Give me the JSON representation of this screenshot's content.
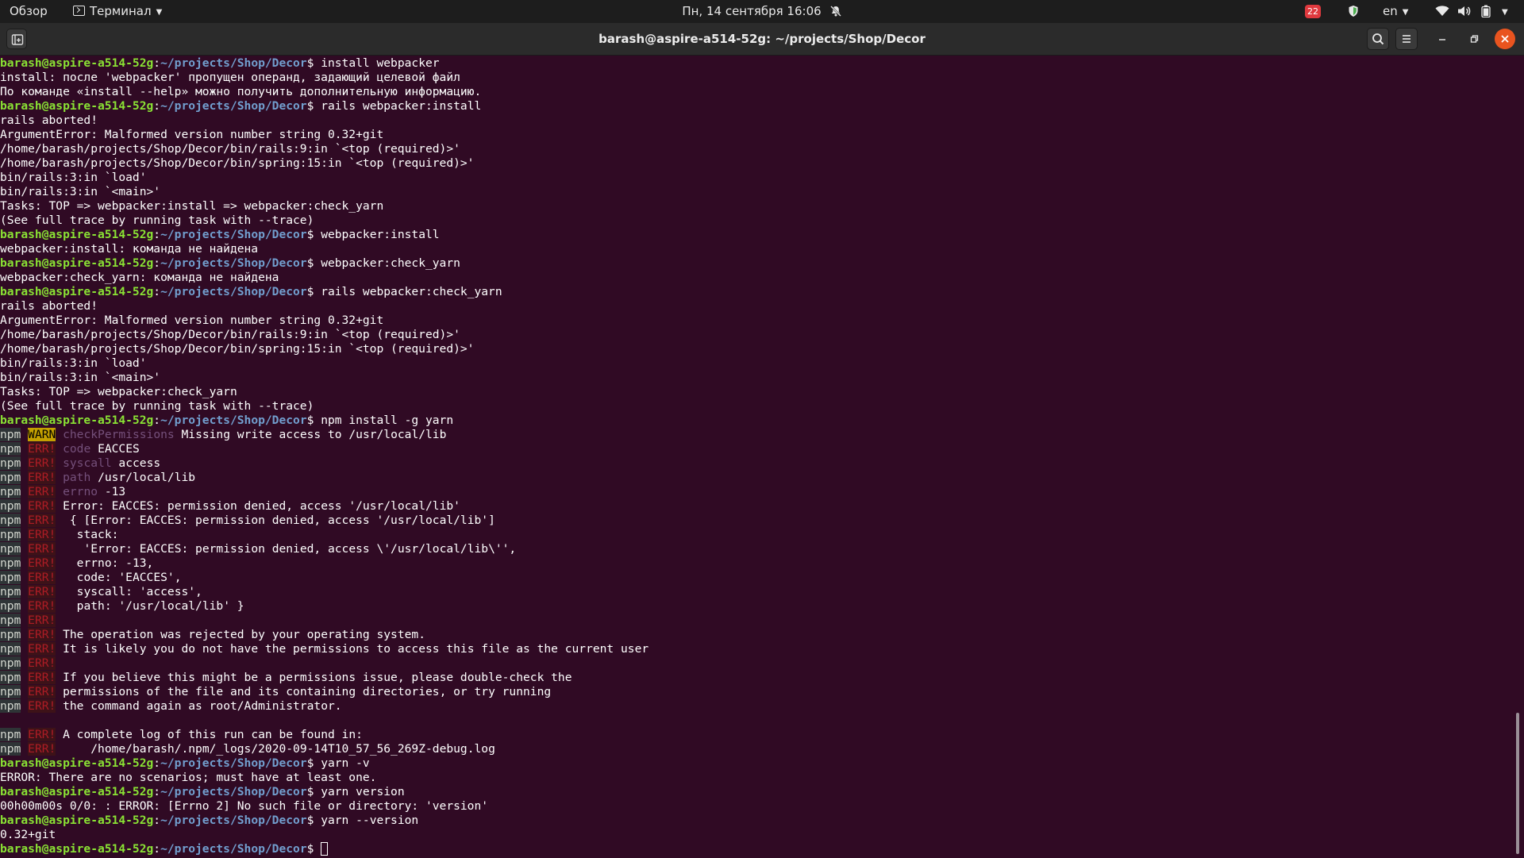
{
  "topbar": {
    "overview": "Обзор",
    "app_name": "Терминал",
    "datetime": "Пн, 14 сентября  16:06",
    "notification_count": "22",
    "language": "en"
  },
  "window": {
    "title": "barash@aspire-a514-52g: ~/projects/Shop/Decor"
  },
  "colors": {
    "terminal_bg": "#300a24",
    "prompt_user": "#8ae234",
    "prompt_path": "#729fcf",
    "npm_warn": "#c4a000",
    "npm_err": "#ad1c25",
    "close_button": "#e9541f"
  },
  "terminal": {
    "prompt_user": "barash@aspire-a514-52g",
    "prompt_path": "~/projects/Shop/Decor",
    "npm": "npm",
    "warn": "WARN",
    "err": "ERR!",
    "lines": [
      {
        "t": "prompt",
        "cmd": "install webpacker"
      },
      {
        "t": "text",
        "text": "install: после 'webpacker' пропущен операнд, задающий целевой файл"
      },
      {
        "t": "text",
        "text": "По команде «install --help» можно получить дополнительную информацию."
      },
      {
        "t": "prompt",
        "cmd": "rails webpacker:install"
      },
      {
        "t": "text",
        "text": "rails aborted!"
      },
      {
        "t": "text",
        "text": "ArgumentError: Malformed version number string 0.32+git"
      },
      {
        "t": "text",
        "text": "/home/barash/projects/Shop/Decor/bin/rails:9:in `<top (required)>'"
      },
      {
        "t": "text",
        "text": "/home/barash/projects/Shop/Decor/bin/spring:15:in `<top (required)>'"
      },
      {
        "t": "text",
        "text": "bin/rails:3:in `load'"
      },
      {
        "t": "text",
        "text": "bin/rails:3:in `<main>'"
      },
      {
        "t": "text",
        "text": "Tasks: TOP => webpacker:install => webpacker:check_yarn"
      },
      {
        "t": "text",
        "text": "(See full trace by running task with --trace)"
      },
      {
        "t": "prompt",
        "cmd": "webpacker:install"
      },
      {
        "t": "text",
        "text": "webpacker:install: команда не найдена"
      },
      {
        "t": "prompt",
        "cmd": "webpacker:check_yarn"
      },
      {
        "t": "text",
        "text": "webpacker:check_yarn: команда не найдена"
      },
      {
        "t": "prompt",
        "cmd": "rails webpacker:check_yarn"
      },
      {
        "t": "text",
        "text": "rails aborted!"
      },
      {
        "t": "text",
        "text": "ArgumentError: Malformed version number string 0.32+git"
      },
      {
        "t": "text",
        "text": "/home/barash/projects/Shop/Decor/bin/rails:9:in `<top (required)>'"
      },
      {
        "t": "text",
        "text": "/home/barash/projects/Shop/Decor/bin/spring:15:in `<top (required)>'"
      },
      {
        "t": "text",
        "text": "bin/rails:3:in `load'"
      },
      {
        "t": "text",
        "text": "bin/rails:3:in `<main>'"
      },
      {
        "t": "text",
        "text": "Tasks: TOP => webpacker:check_yarn"
      },
      {
        "t": "text",
        "text": "(See full trace by running task with --trace)"
      },
      {
        "t": "prompt",
        "cmd": "npm install -g yarn"
      },
      {
        "t": "npm",
        "level": "warn",
        "key": "checkPermissions",
        "text": "Missing write access to /usr/local/lib"
      },
      {
        "t": "npm",
        "level": "err",
        "key": "code",
        "text": "EACCES"
      },
      {
        "t": "npm",
        "level": "err",
        "key": "syscall",
        "text": "access"
      },
      {
        "t": "npm",
        "level": "err",
        "key": "path",
        "text": "/usr/local/lib"
      },
      {
        "t": "npm",
        "level": "err",
        "key": "errno",
        "text": "-13"
      },
      {
        "t": "npm",
        "level": "err",
        "text": "Error: EACCES: permission denied, access '/usr/local/lib'"
      },
      {
        "t": "npm",
        "level": "err",
        "text": " { [Error: EACCES: permission denied, access '/usr/local/lib']"
      },
      {
        "t": "npm",
        "level": "err",
        "text": "  stack:"
      },
      {
        "t": "npm",
        "level": "err",
        "text": "   'Error: EACCES: permission denied, access \\'/usr/local/lib\\'',"
      },
      {
        "t": "npm",
        "level": "err",
        "text": "  errno: -13,"
      },
      {
        "t": "npm",
        "level": "err",
        "text": "  code: 'EACCES',"
      },
      {
        "t": "npm",
        "level": "err",
        "text": "  syscall: 'access',"
      },
      {
        "t": "npm",
        "level": "err",
        "text": "  path: '/usr/local/lib' }"
      },
      {
        "t": "npm",
        "level": "err",
        "text": ""
      },
      {
        "t": "npm",
        "level": "err",
        "text": "The operation was rejected by your operating system."
      },
      {
        "t": "npm",
        "level": "err",
        "text": "It is likely you do not have the permissions to access this file as the current user"
      },
      {
        "t": "npm",
        "level": "err",
        "text": ""
      },
      {
        "t": "npm",
        "level": "err",
        "text": "If you believe this might be a permissions issue, please double-check the"
      },
      {
        "t": "npm",
        "level": "err",
        "text": "permissions of the file and its containing directories, or try running"
      },
      {
        "t": "npm",
        "level": "err",
        "text": "the command again as root/Administrator."
      },
      {
        "t": "blank",
        "text": ""
      },
      {
        "t": "npm",
        "level": "err",
        "text": "A complete log of this run can be found in:"
      },
      {
        "t": "npm",
        "level": "err",
        "text": "    /home/barash/.npm/_logs/2020-09-14T10_57_56_269Z-debug.log"
      },
      {
        "t": "prompt",
        "cmd": "yarn -v"
      },
      {
        "t": "text",
        "text": "ERROR: There are no scenarios; must have at least one."
      },
      {
        "t": "prompt",
        "cmd": "yarn version"
      },
      {
        "t": "text",
        "text": "00h00m00s 0/0: : ERROR: [Errno 2] No such file or directory: 'version'"
      },
      {
        "t": "prompt",
        "cmd": "yarn --version"
      },
      {
        "t": "text",
        "text": "0.32+git"
      },
      {
        "t": "prompt",
        "cmd": "",
        "cursor": true
      }
    ]
  }
}
